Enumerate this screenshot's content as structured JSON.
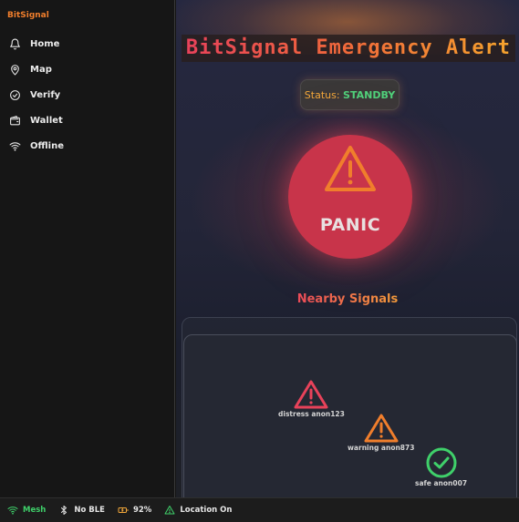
{
  "app": {
    "brand": "BitSignal"
  },
  "sidebar": {
    "items": [
      {
        "label": "Home",
        "icon": "bell-icon"
      },
      {
        "label": "Map",
        "icon": "map-pin-icon"
      },
      {
        "label": "Verify",
        "icon": "check-circle-icon"
      },
      {
        "label": "Wallet",
        "icon": "wallet-icon"
      },
      {
        "label": "Offline",
        "icon": "wifi-icon"
      }
    ]
  },
  "main": {
    "title": "BitSignal Emergency Alert",
    "status_label": "Status:",
    "status_value": "STANDBY",
    "panic_label": "PANIC",
    "nearby_title": "Nearby Signals",
    "signals": [
      {
        "label": "distress anon123",
        "type": "distress",
        "icon": "warning-triangle-icon",
        "color": "#e8425a"
      },
      {
        "label": "warning anon873",
        "type": "warning",
        "icon": "warning-triangle-icon",
        "color": "#f07e2c"
      },
      {
        "label": "safe anon007",
        "type": "safe",
        "icon": "check-circle-icon",
        "color": "#3fd06a"
      }
    ]
  },
  "statusbar": {
    "mesh": "Mesh",
    "ble": "No BLE",
    "battery": "92%",
    "location": "Location On"
  },
  "colors": {
    "accent": "#f07e2c",
    "danger": "#c8344a",
    "standby": "#4fd27b",
    "mesh": "#3fd06a",
    "battery": "#f3a83a"
  }
}
